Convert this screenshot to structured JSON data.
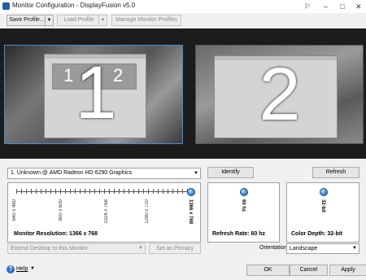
{
  "window": {
    "title": "Monitor Configuration - DisplayFusion v5.0",
    "pin": "⚐",
    "minimize": "–",
    "maximize": "□",
    "close": "✕"
  },
  "toolbar": {
    "save_profile": "Save Profile...",
    "load_profile": "Load Profile",
    "manage_profiles": "Manage Monitor Profiles"
  },
  "monitors": [
    {
      "number": "1",
      "selected": true,
      "inner_labels": [
        "1",
        "2"
      ]
    },
    {
      "number": "2",
      "selected": false
    }
  ],
  "monitor_select": {
    "value": "1. Unknown @ AMD Radeon HD 6290 Graphics"
  },
  "buttons": {
    "identify": "Identify",
    "refresh": "Refresh",
    "set_primary": "Set as Primary",
    "help": "Help",
    "ok": "OK",
    "cancel": "Cancel",
    "apply": "Apply"
  },
  "resolution": {
    "ticks": [
      "640 x 480",
      "800 x 600",
      "1024 x 768",
      "1280 x 720",
      "1366 x 768"
    ],
    "selected_index": 4,
    "label": "Monitor Resolution: 1366 x 768"
  },
  "refresh_rate": {
    "value": "60 hz",
    "label": "Refresh Rate: 60 hz"
  },
  "color_depth": {
    "value": "32-bit",
    "label": "Color Depth: 32-bit"
  },
  "extend_desktop": {
    "value": "Extend Desktop to this Monitor"
  },
  "orientation": {
    "label": "Orientation:",
    "value": "Landscape"
  },
  "colors": {
    "accent": "#3e8fd8",
    "monitor_bg": "#1c1c1c"
  }
}
